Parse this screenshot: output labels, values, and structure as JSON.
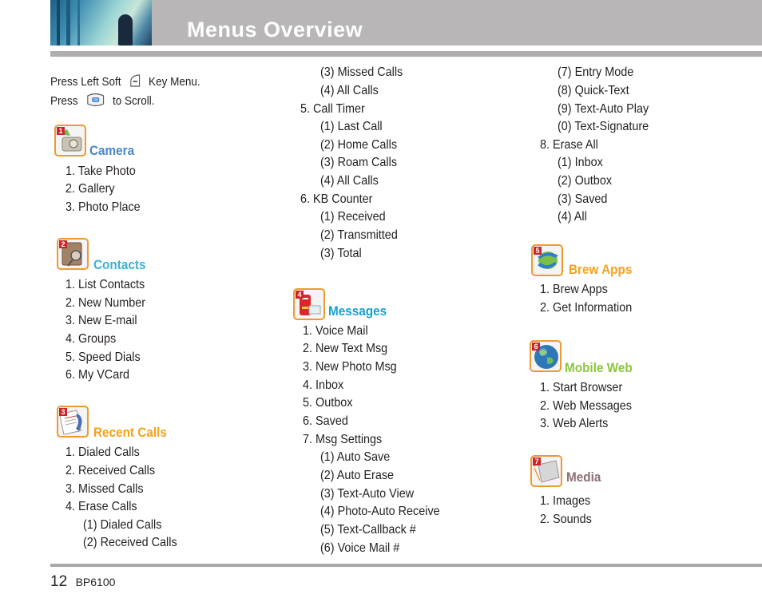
{
  "header": {
    "title": "Menus Overview"
  },
  "intro": {
    "line1_pre": "Press Left Soft",
    "line1_post": "Key Menu.",
    "line2_pre": "Press",
    "line2_post": "to Scroll.",
    "soft_key_icon": "left-soft-key-icon",
    "nav_key_icon": "navigation-ok-key-icon"
  },
  "colors": {
    "camera": "#4a86c8",
    "contacts": "#3bb3d6",
    "recent_calls": "#f4a21c",
    "messages": "#16a0cf",
    "brew_apps": "#f4a21c",
    "mobile_web": "#8cc63f",
    "media": "#8a6f75",
    "icon_border": "#ef9a2f",
    "header_band": "#b8b6b7"
  },
  "sections": {
    "camera": {
      "num": "1",
      "title": "Camera",
      "items": [
        "1. Take Photo",
        "2. Gallery",
        "3. Photo Place"
      ]
    },
    "contacts": {
      "num": "2",
      "title": "Contacts",
      "items": [
        "1. List Contacts",
        "2. New Number",
        "3. New E-mail",
        "4. Groups",
        "5. Speed Dials",
        "6. My VCard"
      ]
    },
    "recent_calls": {
      "num": "3",
      "title": "Recent Calls",
      "items": [
        "1. Dialed Calls",
        "2. Received Calls",
        "3. Missed Calls",
        "4. Erase Calls",
        "(1) Dialed Calls",
        "(2) Received Calls",
        "(3) Missed Calls",
        "(4) All Calls",
        "5. Call Timer",
        "(1) Last Call",
        "(2) Home Calls",
        "(3) Roam Calls",
        "(4) All Calls",
        "6. KB Counter",
        "(1) Received",
        "(2) Transmitted",
        "(3) Total"
      ]
    },
    "messages": {
      "num": "4",
      "title": "Messages",
      "items": [
        "1. Voice Mail",
        "2. New Text Msg",
        "3. New Photo Msg",
        "4. Inbox",
        "5. Outbox",
        "6. Saved",
        "7. Msg Settings",
        "(1) Auto Save",
        "(2) Auto Erase",
        "(3) Text-Auto View",
        "(4) Photo-Auto Receive",
        "(5) Text-Callback #",
        "(6) Voice Mail #",
        "(7) Entry Mode",
        "(8) Quick-Text",
        "(9) Text-Auto Play",
        "(0) Text-Signature",
        "8. Erase All",
        "(1) Inbox",
        "(2) Outbox",
        "(3) Saved",
        "(4) All"
      ]
    },
    "brew_apps": {
      "num": "5",
      "title": "Brew Apps",
      "items": [
        "1. Brew Apps",
        "2. Get Information"
      ]
    },
    "mobile_web": {
      "num": "6",
      "title": "Mobile Web",
      "items": [
        "1. Start Browser",
        "2. Web Messages",
        "3. Web Alerts"
      ]
    },
    "media": {
      "num": "7",
      "title": "Media",
      "items": [
        "1. Images",
        "2. Sounds"
      ]
    }
  },
  "footer": {
    "page_number": "12",
    "model": "BP6100"
  }
}
